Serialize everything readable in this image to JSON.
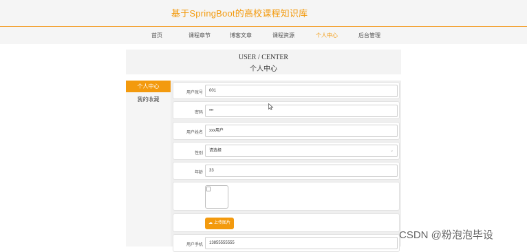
{
  "site": {
    "title": "基于SpringBoot的高校课程知识库"
  },
  "nav": {
    "items": [
      {
        "label": "首页"
      },
      {
        "label": "课程章节"
      },
      {
        "label": "博客文章"
      },
      {
        "label": "课程资源"
      },
      {
        "label": "个人中心"
      },
      {
        "label": "后台管理"
      }
    ],
    "active": "个人中心"
  },
  "center": {
    "title_en": "USER / CENTER",
    "title_cn": "个人中心"
  },
  "sidebar": {
    "items": [
      {
        "label": "个人中心",
        "active": true
      },
      {
        "label": "我的收藏",
        "active": false
      }
    ]
  },
  "form": {
    "account": {
      "label": "用户账号",
      "value": "001"
    },
    "password": {
      "label": "密码",
      "value": "•••"
    },
    "name": {
      "label": "用户姓名",
      "value": "xxx用户"
    },
    "gender": {
      "label": "性别",
      "value": "请选择"
    },
    "age": {
      "label": "年龄",
      "value": "33"
    },
    "upload": {
      "label": "上传图片"
    },
    "phone": {
      "label": "用户手机",
      "value": "13855555555"
    }
  },
  "watermark": {
    "text": "CSDN @粉泡泡毕设"
  },
  "colors": {
    "accent": "#f39a0e",
    "panel_bg": "#efefef",
    "header_bg": "#f5f5f5"
  }
}
